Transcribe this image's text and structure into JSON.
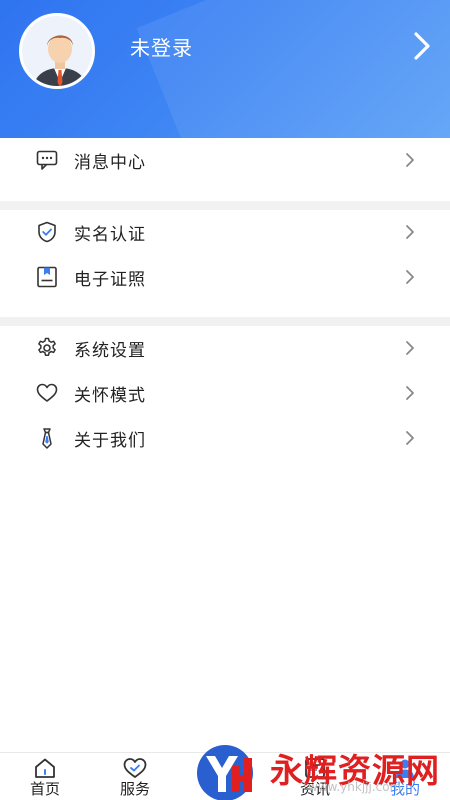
{
  "header": {
    "login_status": "未登录"
  },
  "menu_groups": [
    {
      "items": [
        {
          "label": "消息中心",
          "icon": "message-icon"
        }
      ]
    },
    {
      "items": [
        {
          "label": "实名认证",
          "icon": "shield-check-icon"
        },
        {
          "label": "电子证照",
          "icon": "certificate-icon"
        }
      ]
    },
    {
      "items": [
        {
          "label": "系统设置",
          "icon": "gear-icon"
        },
        {
          "label": "关怀模式",
          "icon": "heart-icon"
        },
        {
          "label": "关于我们",
          "icon": "tie-icon"
        }
      ]
    }
  ],
  "tabbar": {
    "tabs": [
      {
        "label": "首页",
        "icon": "home-icon"
      },
      {
        "label": "服务",
        "icon": "service-heart-icon"
      },
      {
        "label": "资讯",
        "icon": "news-icon"
      },
      {
        "label": "我的",
        "icon": "profile-icon",
        "active": true
      }
    ]
  },
  "watermark": {
    "text": "永辉资源网",
    "url": "www.yhkjjj.com"
  },
  "colors": {
    "header_blue": "#3d84f4",
    "active_tab": "#3a7ef2",
    "separator": "#f1f1f1",
    "watermark_red": "#e02020"
  }
}
